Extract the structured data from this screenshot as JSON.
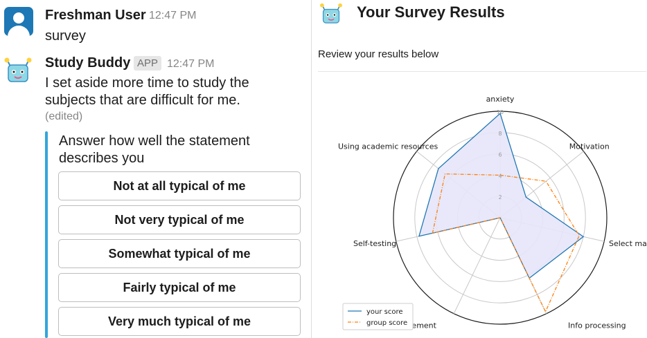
{
  "chat": {
    "user_message": {
      "author": "Freshman User",
      "time": "12:47 PM",
      "text": "survey"
    },
    "bot_message": {
      "author": "Study Buddy",
      "badge": "APP",
      "time": "12:47 PM",
      "text": "I set aside more time to study the subjects that are difficult for me.",
      "edited": "(edited)",
      "question": "Answer how well the statement describes you",
      "options": [
        "Not at all typical of me",
        "Not very typical of me",
        "Somewhat typical of me",
        "Fairly typical of me",
        "Very much typical of me"
      ]
    }
  },
  "survey": {
    "title": "Your Survey Results",
    "subtitle": "Review your results below"
  },
  "chart_data": {
    "type": "radar",
    "axes": [
      "anxiety",
      "Motivation",
      "Select main ideas",
      "Info processing",
      "Time management",
      "Self-testing",
      "Using academic resources"
    ],
    "rlim": [
      0,
      10
    ],
    "r_ticks": [
      "2",
      "4",
      "6",
      "8",
      "10"
    ],
    "grid": true,
    "legend_position": "lower-left",
    "series": [
      {
        "name": "your score",
        "values": [
          9.8,
          3.1,
          8.0,
          6.3,
          0.0,
          7.8,
          7.4
        ],
        "color": "#1f77b4",
        "style": "solid",
        "fill": "#e6e6fa"
      },
      {
        "name": "group score",
        "values": [
          4.0,
          5.5,
          7.6,
          9.8,
          0.0,
          6.5,
          6.6
        ],
        "color": "#ff7f0e",
        "style": "dashdot"
      }
    ]
  },
  "colors": {
    "accent_bar": "#33a6d9",
    "user_avatar": "#1d78b5",
    "bot_avatar": "#8ed8e5"
  }
}
